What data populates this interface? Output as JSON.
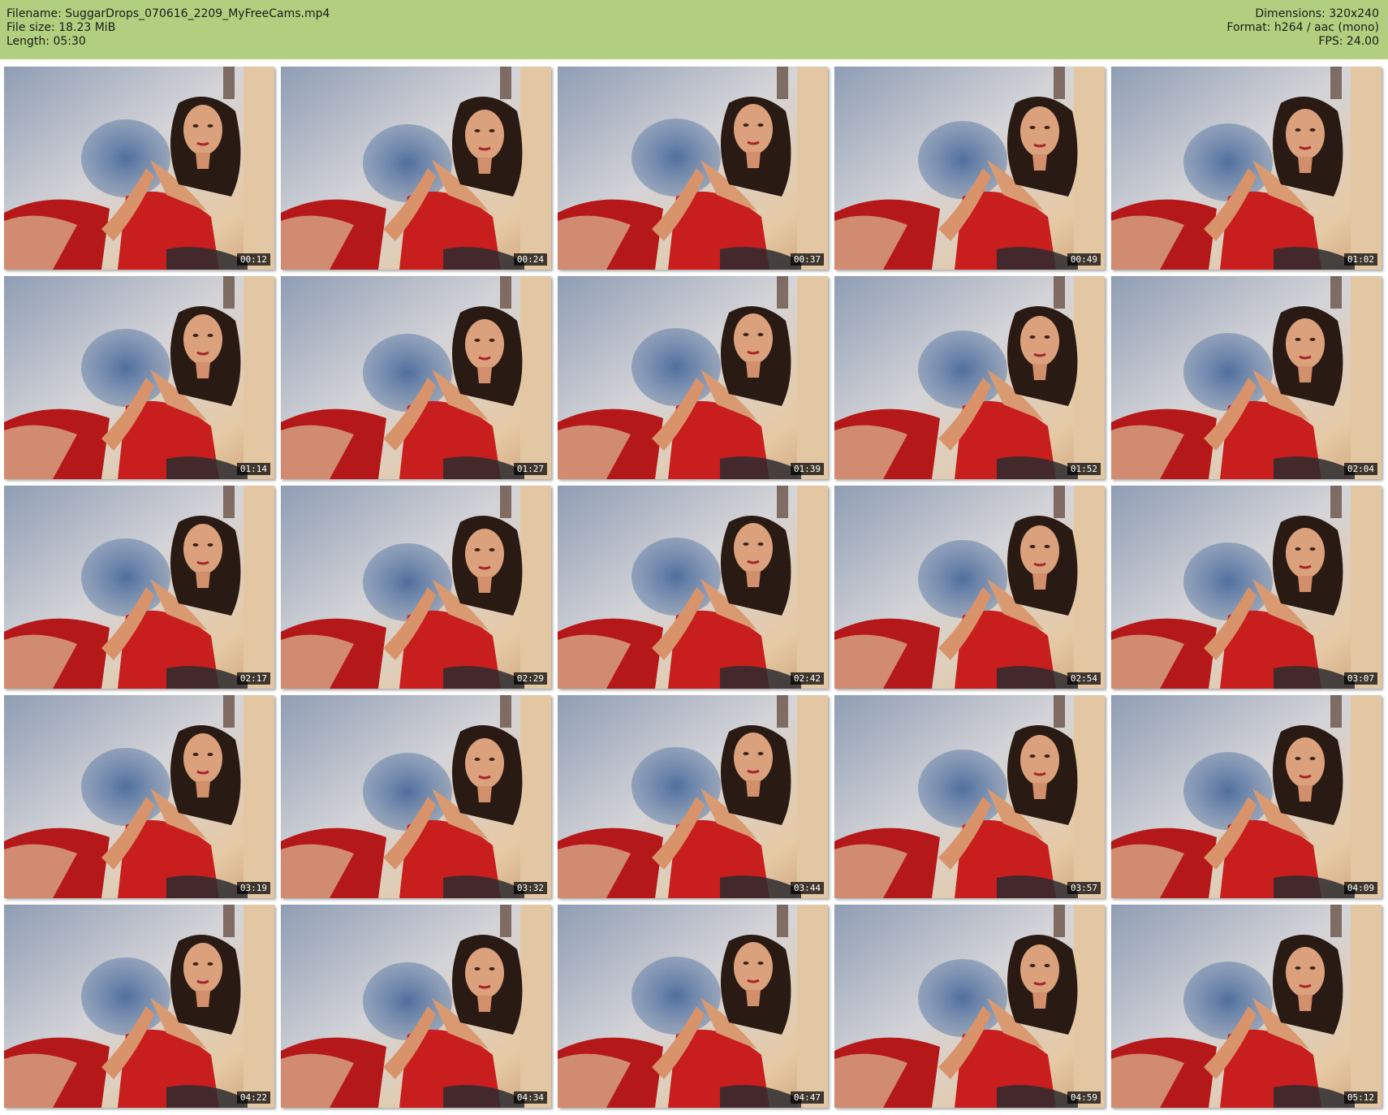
{
  "header": {
    "filename": "Filename: SuggarDrops_070616_2209_MyFreeCams.mp4",
    "filesize": "File size: 18.23 MiB",
    "length": "Length: 05:30",
    "dimensions": "Dimensions: 320x240",
    "format": "Format: h264 / aac (mono)",
    "fps": "FPS: 24.00"
  },
  "thumbnails": [
    {
      "timestamp": "00:12"
    },
    {
      "timestamp": "00:24"
    },
    {
      "timestamp": "00:37"
    },
    {
      "timestamp": "00:49"
    },
    {
      "timestamp": "01:02"
    },
    {
      "timestamp": "01:14"
    },
    {
      "timestamp": "01:27"
    },
    {
      "timestamp": "01:39"
    },
    {
      "timestamp": "01:52"
    },
    {
      "timestamp": "02:04"
    },
    {
      "timestamp": "02:17"
    },
    {
      "timestamp": "02:29"
    },
    {
      "timestamp": "02:42"
    },
    {
      "timestamp": "02:54"
    },
    {
      "timestamp": "03:07"
    },
    {
      "timestamp": "03:19"
    },
    {
      "timestamp": "03:32"
    },
    {
      "timestamp": "03:44"
    },
    {
      "timestamp": "03:57"
    },
    {
      "timestamp": "04:09"
    },
    {
      "timestamp": "04:22"
    },
    {
      "timestamp": "04:34"
    },
    {
      "timestamp": "04:47"
    },
    {
      "timestamp": "04:59"
    },
    {
      "timestamp": "05:12"
    }
  ],
  "colors": {
    "header_bg": "#b1cf7f",
    "dress": "#c81e1e",
    "hair": "#2a1a14",
    "skin": "#d99a72"
  }
}
